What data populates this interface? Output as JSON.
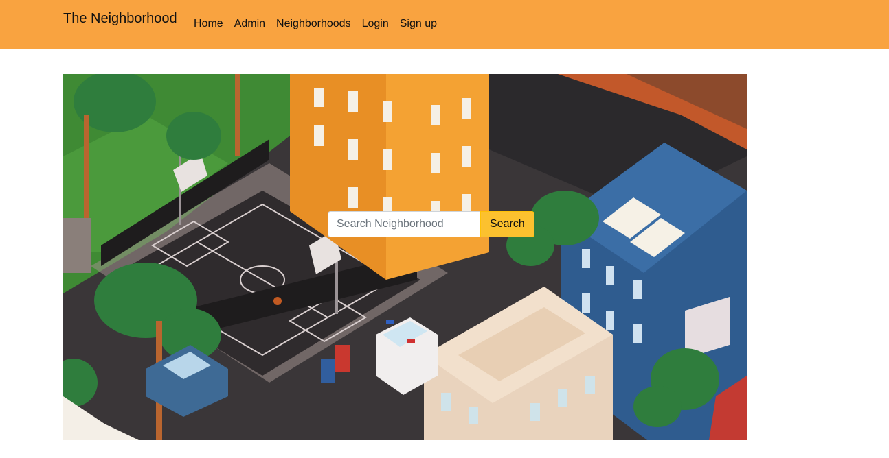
{
  "navbar": {
    "brand": "The Neighborhood",
    "links": [
      {
        "label": "Home"
      },
      {
        "label": "Admin"
      },
      {
        "label": "Neighborhoods"
      },
      {
        "label": "Login"
      },
      {
        "label": "Sign up"
      }
    ],
    "background_color": "#f9a340"
  },
  "hero": {
    "image_description_icon": "isometric-city-illustration",
    "search": {
      "placeholder": "Search Neighborhood",
      "value": "",
      "button_label": "Search",
      "button_color": "#fcc12f"
    }
  }
}
